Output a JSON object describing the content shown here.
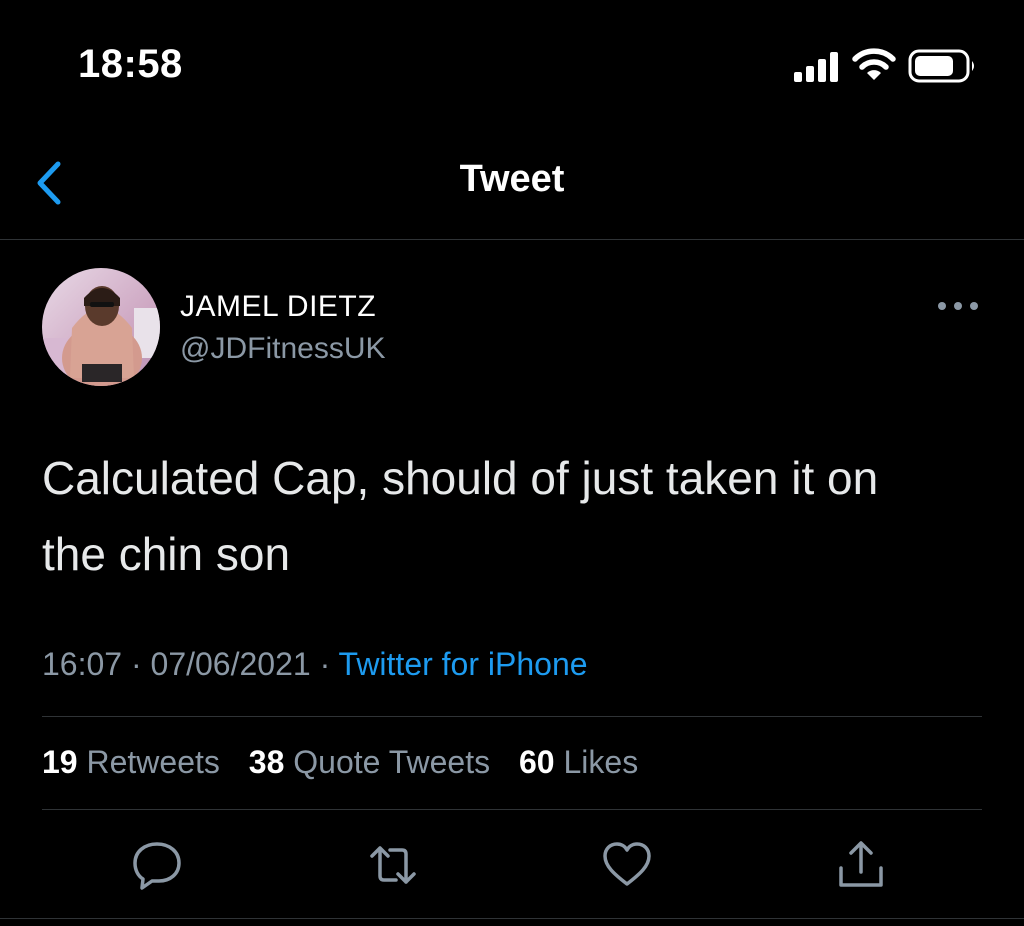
{
  "status_bar": {
    "time": "18:58",
    "icons": [
      "cellular-signal-icon",
      "wifi-icon",
      "battery-icon"
    ]
  },
  "nav": {
    "back_icon": "chevron-left-icon",
    "title": "Tweet"
  },
  "tweet": {
    "author": {
      "display_name": "JAMEL DIETZ",
      "handle": "@JDFitnessUK"
    },
    "more_icon": "ellipsis-icon",
    "text_line1": "Calculated Cap, should of just taken it on",
    "text_line2": "the chin son",
    "time": "16:07",
    "separator": "·",
    "date": "07/06/2021",
    "source": "Twitter for iPhone",
    "stats": {
      "retweets_count": "19",
      "retweets_label": "Retweets",
      "quotes_count": "38",
      "quotes_label": "Quote Tweets",
      "likes_count": "60",
      "likes_label": "Likes"
    },
    "actions": [
      "reply-icon",
      "retweet-icon",
      "like-icon",
      "share-icon"
    ]
  },
  "colors": {
    "background": "#000000",
    "text": "#e7e9ea",
    "secondary_text": "#8b98a5",
    "accent": "#1d9bf0",
    "divider": "#2f3336"
  }
}
